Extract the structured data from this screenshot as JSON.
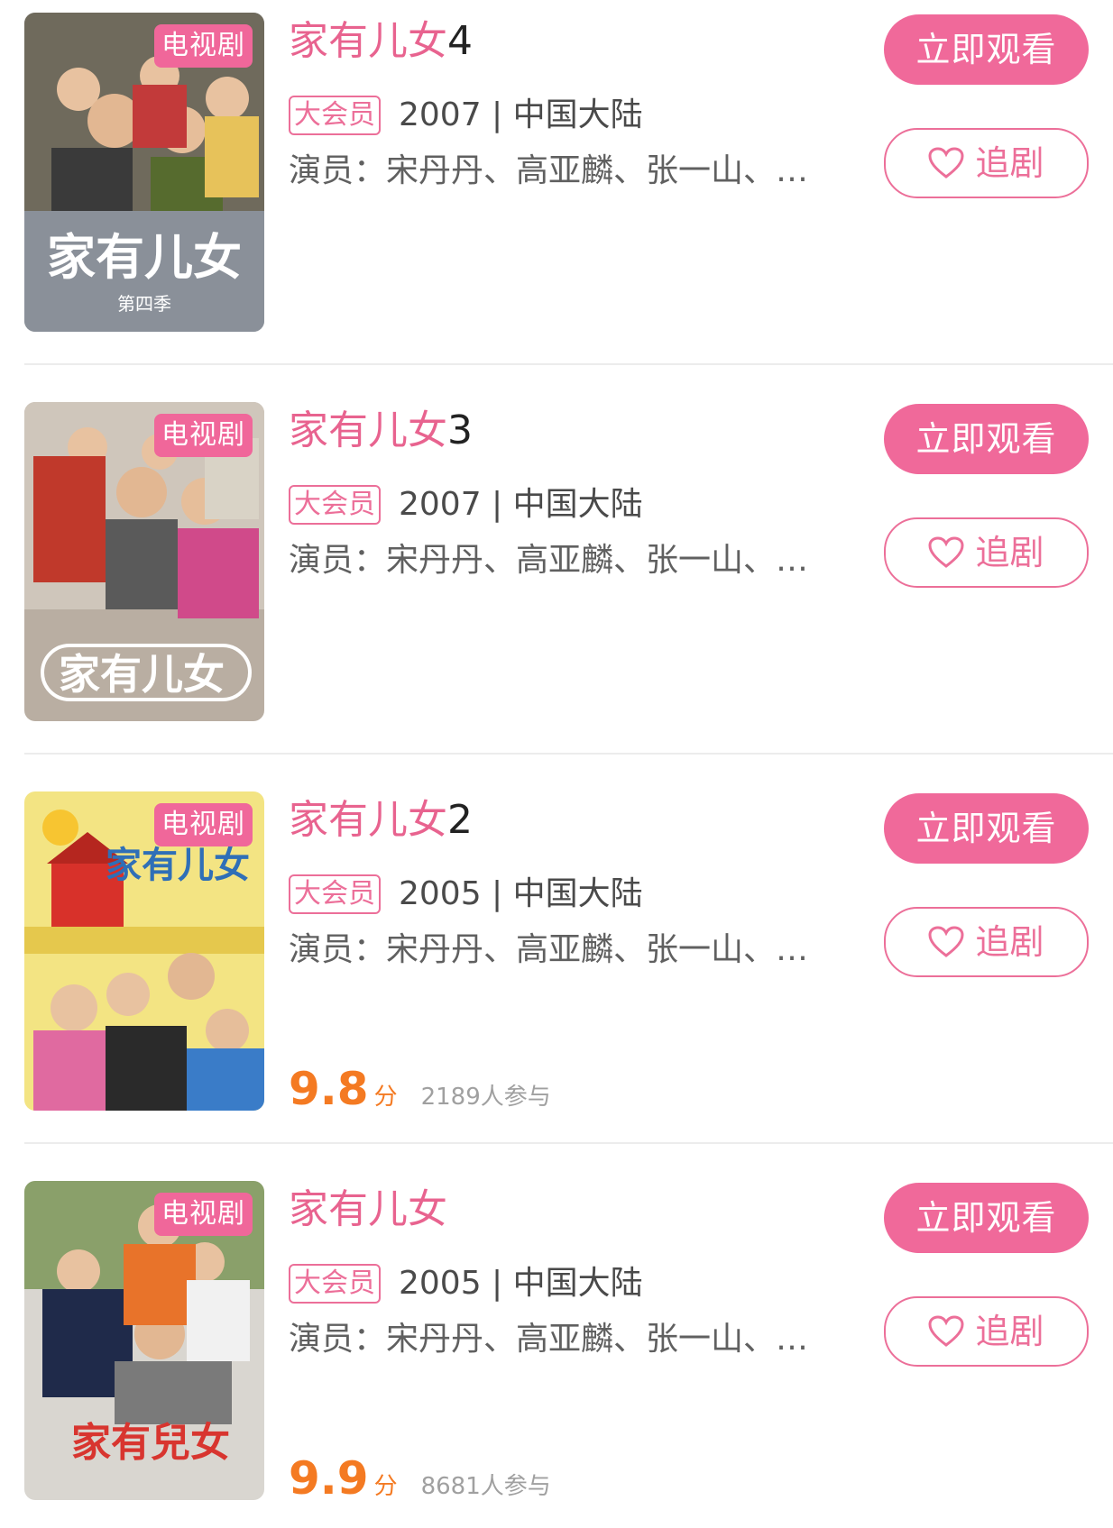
{
  "items": [
    {
      "type_badge": "电视剧",
      "title_main": "家有儿女",
      "title_suffix": "4",
      "vip_badge": "大会员",
      "year_region": "2007 | 中国大陆",
      "cast": "演员：宋丹丹、高亚麟、张一山、…",
      "watch_label": "立即观看",
      "follow_label": "追剧",
      "poster_title": "家有儿女",
      "poster_subtitle": "第四季",
      "poster_colors": [
        "#8a9099",
        "#c23a3a",
        "#5f7a3a"
      ]
    },
    {
      "type_badge": "电视剧",
      "title_main": "家有儿女",
      "title_suffix": "3",
      "vip_badge": "大会员",
      "year_region": "2007 | 中国大陆",
      "cast": "演员：宋丹丹、高亚麟、张一山、…",
      "watch_label": "立即观看",
      "follow_label": "追剧",
      "poster_title": "家有儿女",
      "poster_subtitle": "",
      "poster_colors": [
        "#b6ab9f",
        "#c0392b",
        "#d04a8a"
      ]
    },
    {
      "type_badge": "电视剧",
      "title_main": "家有儿女",
      "title_suffix": "2",
      "vip_badge": "大会员",
      "year_region": "2005 | 中国大陆",
      "cast": "演员：宋丹丹、高亚麟、张一山、…",
      "watch_label": "立即观看",
      "follow_label": "追剧",
      "score": "9.8",
      "score_unit": "分",
      "participants": "2189人参与",
      "poster_title": "家有儿女",
      "poster_subtitle": "",
      "poster_colors": [
        "#f3e483",
        "#d8312a",
        "#2f6fb7"
      ]
    },
    {
      "type_badge": "电视剧",
      "title_main": "家有儿女",
      "title_suffix": "",
      "vip_badge": "大会员",
      "year_region": "2005 | 中国大陆",
      "cast": "演员：宋丹丹、高亚麟、张一山、…",
      "watch_label": "立即观看",
      "follow_label": "追剧",
      "score": "9.9",
      "score_unit": "分",
      "participants": "8681人参与",
      "poster_title": "家有兒女",
      "poster_subtitle": "",
      "poster_colors": [
        "#d9d6d0",
        "#e8732a",
        "#1f2a4a"
      ]
    }
  ],
  "colors": {
    "accent_pink": "#f0699a",
    "score_orange": "#f47a22",
    "divider": "#ececec"
  }
}
